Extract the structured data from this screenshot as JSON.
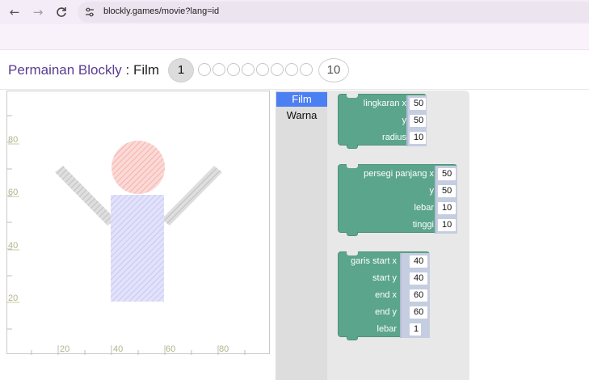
{
  "browser": {
    "url": "blockly.games/movie?lang=id",
    "back_icon": "←",
    "forward_icon": "→",
    "reload_icon": "C"
  },
  "header": {
    "game_name": "Permainan Blockly",
    "separator": " : ",
    "level_name": "Film",
    "current_level": "1",
    "last_level": "10"
  },
  "display": {
    "y_ticks": [
      "80",
      "60",
      "40",
      "20"
    ],
    "x_ticks": [
      "20",
      "40",
      "60",
      "80"
    ]
  },
  "toolbox": {
    "categories": [
      "Film",
      "Warna"
    ]
  },
  "blocks": {
    "circle": {
      "labels": [
        "lingkaran x",
        "y",
        "radius"
      ],
      "values": [
        "50",
        "50",
        "10"
      ]
    },
    "rect": {
      "labels": [
        "persegi panjang x",
        "y",
        "lebar",
        "tinggi"
      ],
      "values": [
        "50",
        "50",
        "10",
        "10"
      ]
    },
    "line": {
      "labels": [
        "garis start x",
        "start y",
        "end x",
        "end y",
        "lebar"
      ],
      "values": [
        "40",
        "40",
        "60",
        "60",
        "1"
      ]
    }
  }
}
